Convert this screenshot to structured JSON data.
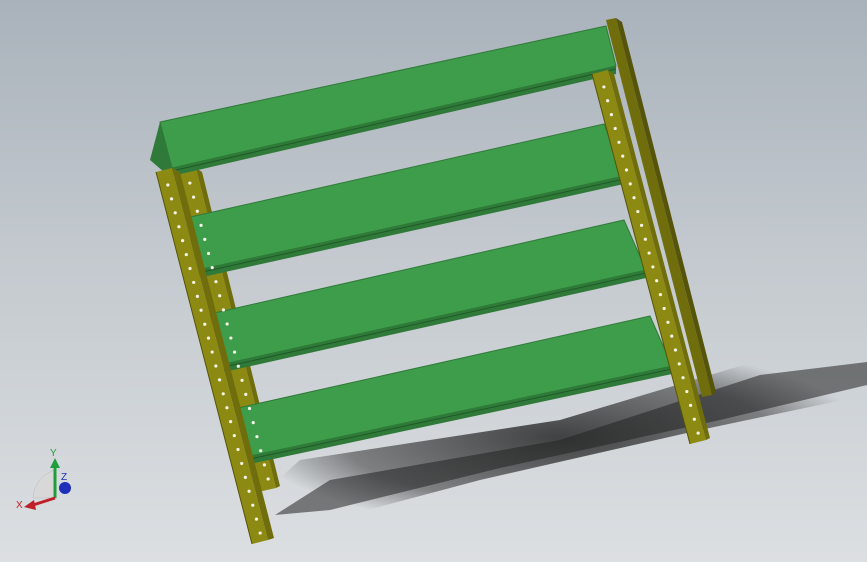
{
  "viewport": {
    "background_top": "#a9b2bb",
    "background_bottom": "#dcdfe2"
  },
  "model": {
    "shelf_color": "#3e9d4a",
    "shelf_edge_color": "#2f7a38",
    "upright_color": "#8c8a12",
    "upright_dark_color": "#6f6d0c",
    "hole_color": "#f2f2e6",
    "shadow_color": "#2a2a2a",
    "shelf_count": 4,
    "upright_count": 4
  },
  "triad": {
    "x_label": "X",
    "y_label": "Y",
    "z_label": "Z",
    "x_color": "#c0202a",
    "y_color": "#1f9e3b",
    "z_color": "#1d2fb8"
  }
}
